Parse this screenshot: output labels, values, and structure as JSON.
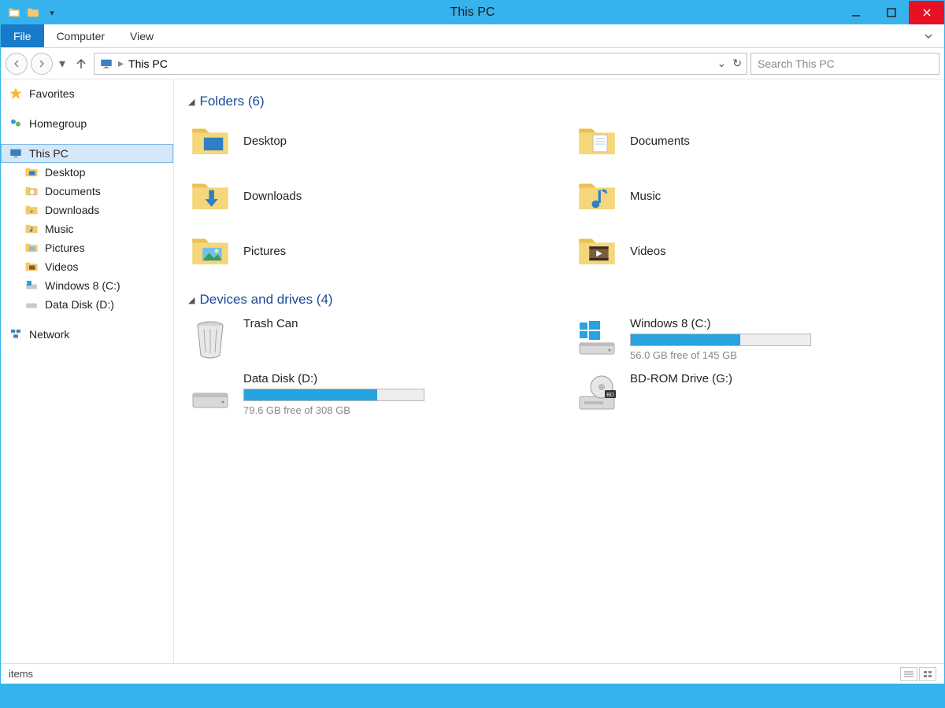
{
  "window": {
    "title": "This PC"
  },
  "ribbon": {
    "file": "File",
    "tabs": [
      "Computer",
      "View"
    ]
  },
  "address": {
    "root": "This PC",
    "search_placeholder": "Search This PC"
  },
  "sidebar": {
    "favorites": "Favorites",
    "homegroup": "Homegroup",
    "thispc": "This PC",
    "children": [
      "Desktop",
      "Documents",
      "Downloads",
      "Music",
      "Pictures",
      "Videos",
      "Windows 8 (C:)",
      "Data Disk (D:)"
    ],
    "network": "Network"
  },
  "groups": {
    "folders_header": "Folders (6)",
    "drives_header": "Devices and drives (4)"
  },
  "folders": [
    {
      "name": "Desktop"
    },
    {
      "name": "Documents"
    },
    {
      "name": "Downloads"
    },
    {
      "name": "Music"
    },
    {
      "name": "Pictures"
    },
    {
      "name": "Videos"
    }
  ],
  "drives": [
    {
      "name": "Trash Can",
      "type": "trash"
    },
    {
      "name": "Windows 8 (C:)",
      "type": "os",
      "free": "56.0 GB free of 145 GB",
      "used_pct": 61
    },
    {
      "name": "Data Disk (D:)",
      "type": "hdd",
      "free": "79.6 GB free of 308 GB",
      "used_pct": 74
    },
    {
      "name": "BD-ROM Drive (G:)",
      "type": "optical"
    }
  ],
  "status": {
    "text": "items"
  }
}
